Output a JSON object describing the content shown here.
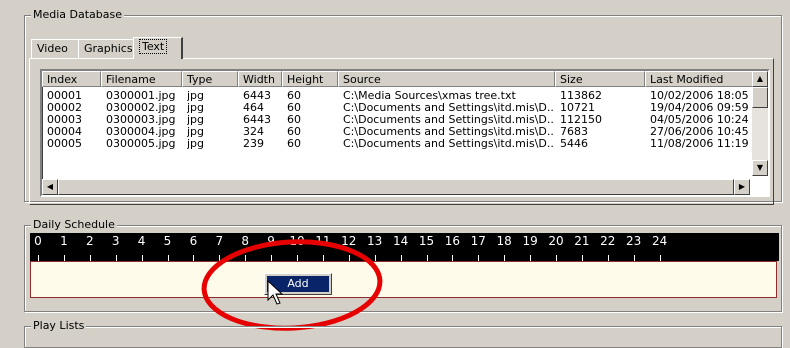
{
  "media_database": {
    "title": "Media Database",
    "tabs": [
      {
        "label": "Video"
      },
      {
        "label": "Graphics"
      },
      {
        "label": "Text",
        "active": true
      }
    ],
    "columns": [
      "Index",
      "Filename",
      "Type",
      "Width",
      "Height",
      "Source",
      "Size",
      "Last Modified"
    ],
    "rows": [
      [
        "00001",
        "0300001.jpg",
        "jpg",
        "6443",
        "60",
        "C:\\Media Sources\\xmas tree.txt",
        "113862",
        "10/02/2006 18:05"
      ],
      [
        "00002",
        "0300002.jpg",
        "jpg",
        "464",
        "60",
        "C:\\Documents and Settings\\itd.mis\\D...",
        "10721",
        "19/04/2006 09:59"
      ],
      [
        "00003",
        "0300003.jpg",
        "jpg",
        "6443",
        "60",
        "C:\\Documents and Settings\\itd.mis\\D...",
        "112150",
        "04/05/2006 10:24"
      ],
      [
        "00004",
        "0300004.jpg",
        "jpg",
        "324",
        "60",
        "C:\\Documents and Settings\\itd.mis\\D...",
        "7683",
        "27/06/2006 10:45"
      ],
      [
        "00005",
        "0300005.jpg",
        "jpg",
        "239",
        "60",
        "C:\\Documents and Settings\\itd.mis\\D...",
        "5446",
        "11/08/2006 11:19"
      ]
    ]
  },
  "daily_schedule": {
    "title": "Daily Schedule",
    "hours": [
      "0",
      "1",
      "2",
      "3",
      "4",
      "5",
      "6",
      "7",
      "8",
      "9",
      "10",
      "11",
      "12",
      "13",
      "14",
      "15",
      "16",
      "17",
      "18",
      "19",
      "20",
      "21",
      "22",
      "23",
      "24"
    ],
    "context_menu": {
      "items": [
        "Add"
      ]
    }
  },
  "play_lists": {
    "title": "Play Lists"
  },
  "annotation": {
    "color": "#e60000"
  }
}
